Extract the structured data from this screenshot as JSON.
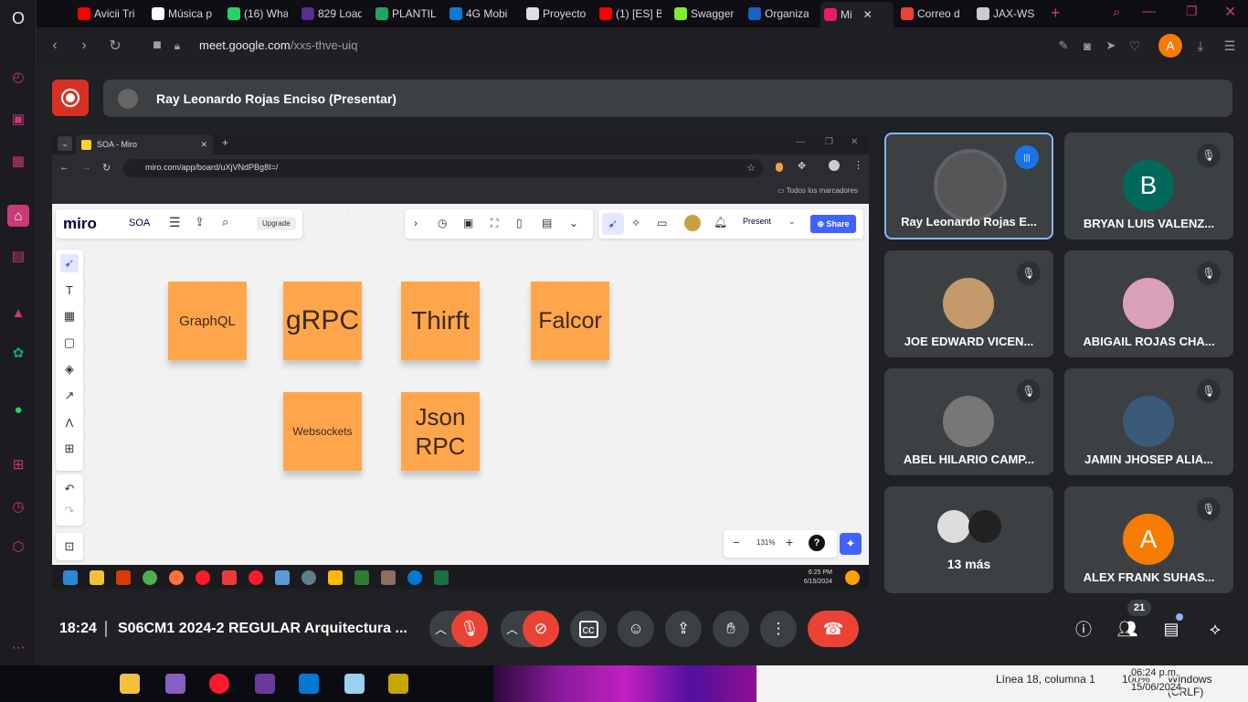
{
  "browser": {
    "tabs": [
      {
        "label": "Avicii Tri",
        "color": "#ff0000"
      },
      {
        "label": "Música p",
        "color": "#ffffff"
      },
      {
        "label": "(16) Wha",
        "color": "#25d366"
      },
      {
        "label": "829 Load",
        "color": "#5a2d91"
      },
      {
        "label": "PLANTILL",
        "color": "#1fa463"
      },
      {
        "label": "4G Mobi",
        "color": "#0a7bd4"
      },
      {
        "label": "Proyecto",
        "color": "#e0e0e0"
      },
      {
        "label": "(1) [ES] B",
        "color": "#ff0000"
      },
      {
        "label": "Swagger",
        "color": "#85ea2d"
      },
      {
        "label": "Organiza",
        "color": "#1565c0"
      },
      {
        "label": "Mi",
        "color": "#e91e63"
      },
      {
        "label": "Correo d",
        "color": "#ea4335"
      },
      {
        "label": "JAX-WS",
        "color": "#cccccc"
      }
    ],
    "url_prefix": "meet.google.com",
    "url_path": "/xxs-thve-uiq",
    "profile_initial": "A"
  },
  "meet": {
    "presenter_label": "Ray Leonardo Rojas Enciso (Presentar)",
    "time": "18:24",
    "meeting_title": "S06CM1 2024-2 REGULAR Arquitectura ...",
    "participant_count": "21",
    "participants": [
      {
        "name": "Ray Leonardo Rojas E...",
        "initial": "",
        "color": "#555"
      },
      {
        "name": "BRYAN LUIS VALENZ...",
        "initial": "B",
        "color": "#00695c"
      },
      {
        "name": "JOE EDWARD VICEN...",
        "initial": "",
        "color": "#c49a6c"
      },
      {
        "name": "ABIGAIL ROJAS CHA...",
        "initial": "",
        "color": "#d9a0b8"
      },
      {
        "name": "ABEL HILARIO CAMP...",
        "initial": "",
        "color": "#777"
      },
      {
        "name": "JAMIN JHOSEP ALIA...",
        "initial": "",
        "color": "#3a5a7a"
      },
      {
        "name": "13 más",
        "initial": "",
        "color": "#444"
      },
      {
        "name": "ALEX FRANK SUHAS...",
        "initial": "A",
        "color": "#f57c00"
      }
    ]
  },
  "shared_screen": {
    "tab_title": "SOA - Miro",
    "url": "miro.com/app/board/uXjVNdPBg8I=/",
    "bookmarks": "Todos los marcadores",
    "board_name": "SOA",
    "upgrade_label": "Upgrade",
    "present_label": "Present",
    "share_label": "Share",
    "zoom": "131%",
    "clock_time": "6:25 PM",
    "clock_date": "6/15/2024",
    "stickies": [
      "GraphQL",
      "gRPC",
      "Thirft",
      "Falcor",
      "Websockets",
      "Json RPC"
    ]
  },
  "taskbar": {
    "status_text": "Línea 18, columna 1",
    "zoom_text": "100%",
    "encoding": "Windows (CRLF)",
    "clock": "06:24 p.m.",
    "date": "15/06/2024"
  }
}
